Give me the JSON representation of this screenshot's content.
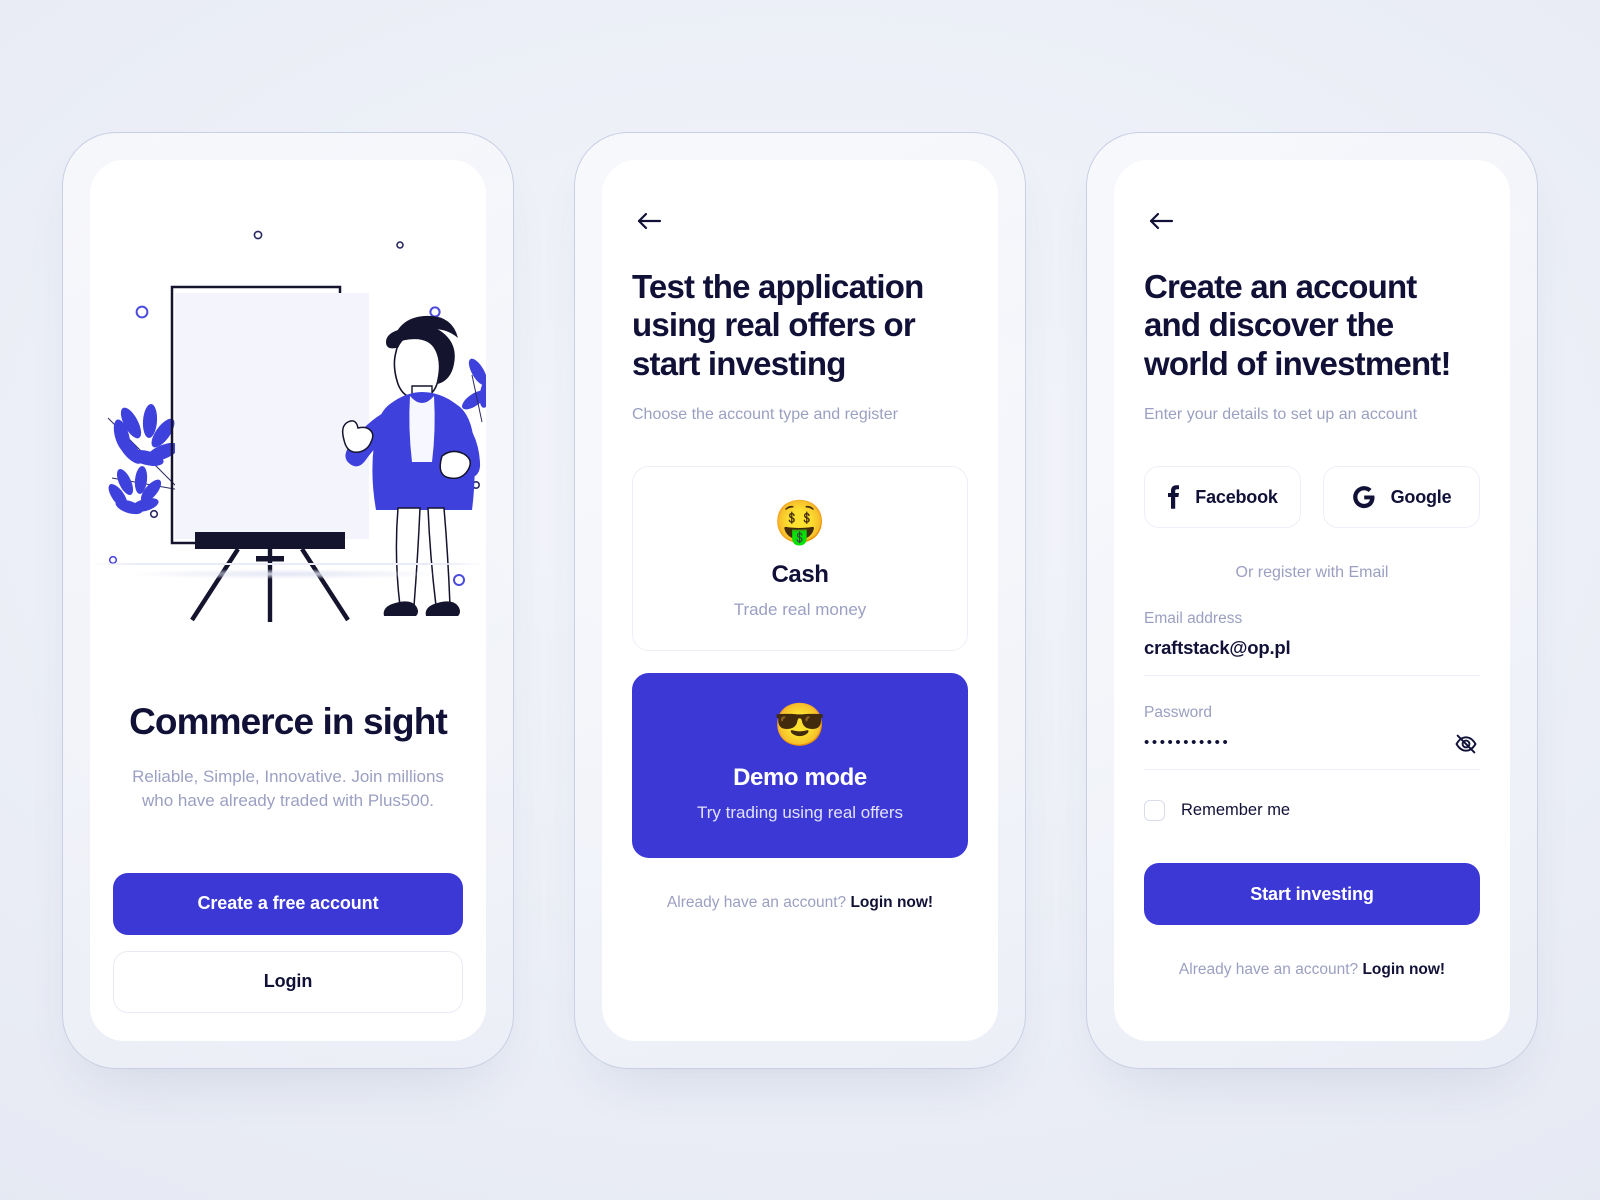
{
  "theme": {
    "primary": "#3b38d6",
    "ink": "#111138",
    "muted": "#9ba0c2",
    "border": "#edeff6",
    "canvas": "#eceff7"
  },
  "screens": [
    {
      "id": "onboarding",
      "illustration": {
        "name": "presenter-whiteboard-illustration",
        "alt": "Person presenting at a whiteboard easel"
      },
      "title": "Commerce in sight",
      "subtitle": "Reliable, Simple, Innovative. Join millions who have already traded with Plus500.",
      "primary_button": "Create a free account",
      "secondary_button": "Login"
    },
    {
      "id": "account-type",
      "back_icon": "arrow-left-icon",
      "title": "Test the application using real offers or start investing",
      "subtitle": "Choose the account type and register",
      "options": [
        {
          "emoji": "🤑",
          "emoji_name": "money-mouth-face-emoji",
          "title": "Cash",
          "description": "Trade real money",
          "selected": false
        },
        {
          "emoji": "😎",
          "emoji_name": "smiling-face-with-sunglasses-emoji",
          "title": "Demo mode",
          "description": "Try trading using real offers",
          "selected": true
        }
      ],
      "footnote_text": "Already have an account?",
      "footnote_link": "Login now!"
    },
    {
      "id": "register",
      "back_icon": "arrow-left-icon",
      "title": "Create an account and discover the world of investment!",
      "subtitle": "Enter your details to set up an account",
      "social_buttons": [
        {
          "label": "Facebook",
          "icon": "facebook-icon"
        },
        {
          "label": "Google",
          "icon": "google-icon"
        }
      ],
      "divider_text": "Or register with Email",
      "email_field": {
        "label": "Email address",
        "value": "craftstack@op.pl",
        "placeholder": "Email address"
      },
      "password_field": {
        "label": "Password",
        "masked_value": "•••••••••••",
        "toggle_icon": "eye-off-icon",
        "visible": false
      },
      "remember_me": {
        "label": "Remember me",
        "checked": false
      },
      "submit_button": "Start investing",
      "footnote_text": "Already have an account?",
      "footnote_link": "Login now!"
    }
  ]
}
